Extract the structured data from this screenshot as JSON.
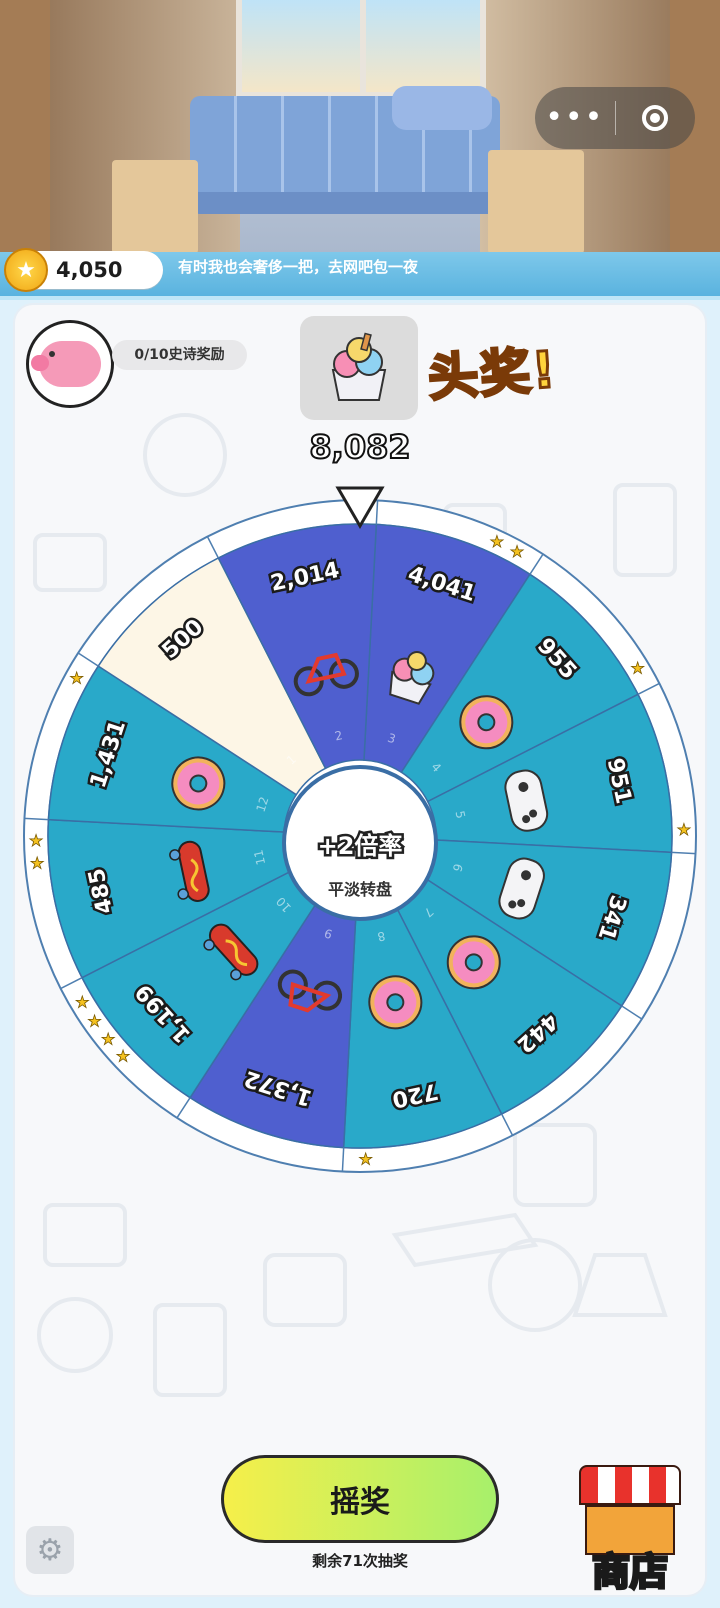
{
  "status_bar": {
    "coins": "4,050",
    "ticker": "有时我也会奢侈一把，去网吧包一夜"
  },
  "mini_program_capsule": {
    "more_icon": "more-dots-icon",
    "close_icon": "target-close-icon"
  },
  "top_section": {
    "piggy_bank_icon": "piggy-bank-icon",
    "epic_progress": "0/10史诗奖励",
    "grand_prize_label": "头奖!",
    "grand_prize_icon": "ice-cream-icon",
    "grand_prize_value": "8,082"
  },
  "wheel": {
    "center_title": "+2倍率",
    "center_subtitle": "平淡转盘",
    "pointer_icon": "pointer-triangle-icon",
    "segments": [
      {
        "value": "4,041",
        "icon": "ice-cream",
        "color": "#4f5fcf",
        "number": "3",
        "stars": 2
      },
      {
        "value": "955",
        "icon": "donut",
        "color": "#29a9c9",
        "number": "4",
        "stars": 1
      },
      {
        "value": "951",
        "icon": "gamepad",
        "color": "#29a9c9",
        "number": "5",
        "stars": 1
      },
      {
        "value": "341",
        "icon": "gamepad",
        "color": "#29a9c9",
        "number": "6",
        "stars": 0
      },
      {
        "value": "442",
        "icon": "donut",
        "color": "#29a9c9",
        "number": "7",
        "stars": 0
      },
      {
        "value": "720",
        "icon": "donut",
        "color": "#29a9c9",
        "number": "8",
        "stars": 1
      },
      {
        "value": "1,372",
        "icon": "bicycle",
        "color": "#4f5fcf",
        "number": "9",
        "stars": 0
      },
      {
        "value": "1,199",
        "icon": "skateboard",
        "color": "#29a9c9",
        "number": "10",
        "stars": 4
      },
      {
        "value": "485",
        "icon": "skateboard",
        "color": "#29a9c9",
        "number": "11",
        "stars": 2
      },
      {
        "value": "1,431",
        "icon": "donut",
        "color": "#29a9c9",
        "number": "12",
        "stars": 1
      },
      {
        "value": "500",
        "icon": "",
        "color": "#fdf6e6",
        "number": "1",
        "stars": 0
      },
      {
        "value": "2,014",
        "icon": "bicycle",
        "color": "#4f5fcf",
        "number": "2",
        "stars": 0
      }
    ]
  },
  "bottom": {
    "spin_label": "摇奖",
    "remaining": "剩余71次抽奖",
    "settings_icon": "gear-icon",
    "shop_label": "商店",
    "shop_icon": "storefront-icon"
  }
}
